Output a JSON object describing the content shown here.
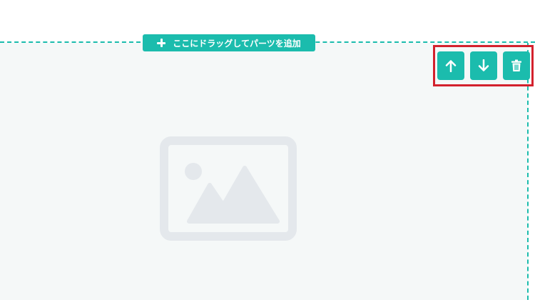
{
  "top_text": {
    "items": [
      "",
      "",
      ""
    ]
  },
  "drop_zone": {
    "add_label": "ここにドラッグしてパーツを追加"
  },
  "block_controls": {
    "move_up_icon": "arrow-up-icon",
    "move_down_icon": "arrow-down-icon",
    "delete_icon": "trash-icon"
  },
  "colors": {
    "accent": "#1bbcad",
    "highlight": "#d3212d",
    "placeholder": "#e4e8ec",
    "area_bg": "#f5f8f8"
  },
  "content": {
    "image_icon": "image-placeholder-icon"
  }
}
